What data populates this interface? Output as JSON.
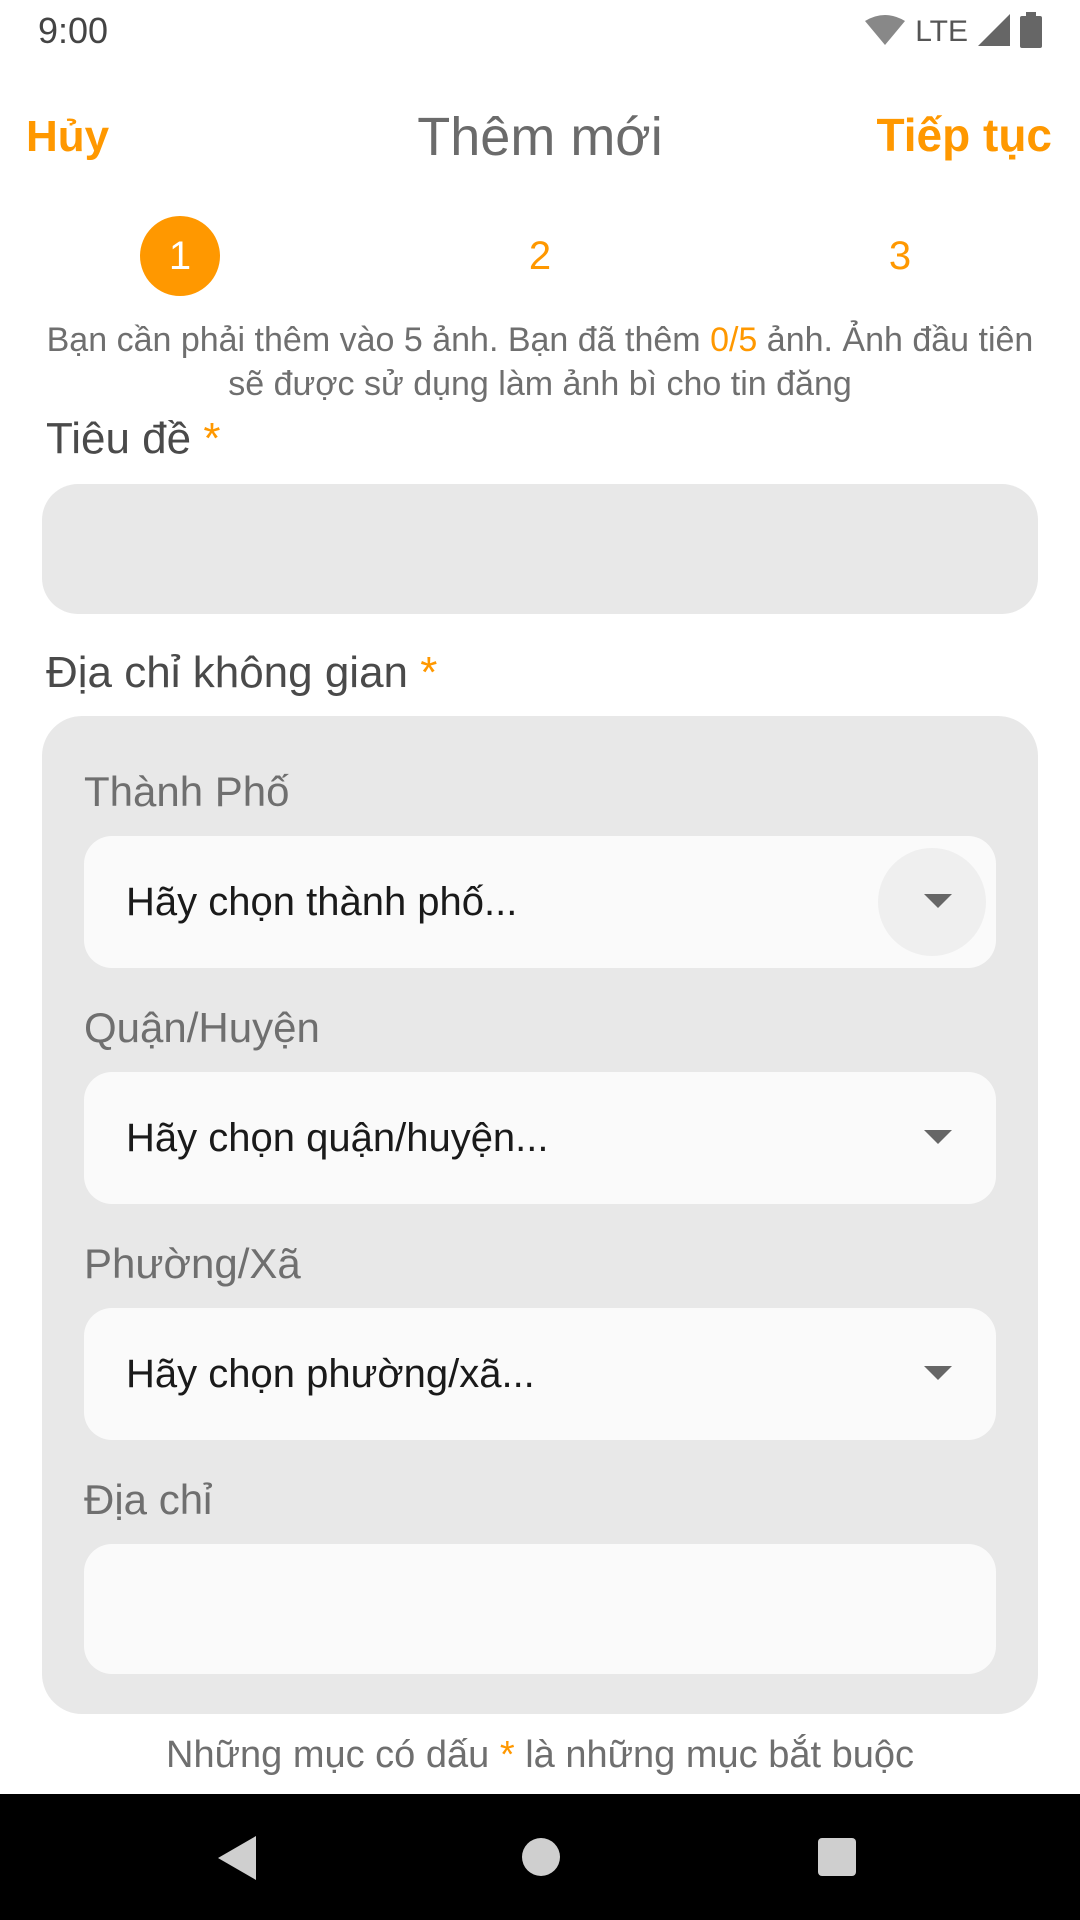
{
  "status_bar": {
    "time": "9:00",
    "network": "LTE",
    "icons": [
      "wifi-icon",
      "signal-icon",
      "battery-icon"
    ]
  },
  "app_bar": {
    "cancel_label": "Hủy",
    "title": "Thêm mới",
    "next_label": "Tiếp tục"
  },
  "steps": {
    "items": [
      "1",
      "2",
      "3"
    ],
    "active_index": 0
  },
  "hint": {
    "before": "Bạn cần phải thêm vào 5 ảnh. Bạn đã thêm ",
    "count": "0/5",
    "after": " ảnh. Ảnh đầu tiên sẽ được sử dụng làm ảnh bì cho tin đăng"
  },
  "form": {
    "title_label": "Tiêu đề",
    "required_mark": "*",
    "title_value": "",
    "address_label": "Địa chỉ không gian",
    "city_label": "Thành Phố",
    "city_placeholder": "Hãy chọn thành phố...",
    "district_label": "Quận/Huyện",
    "district_placeholder": "Hãy chọn quận/huyện...",
    "ward_label": "Phường/Xã",
    "ward_placeholder": "Hãy chọn phường/xã...",
    "street_label": "Địa chỉ",
    "street_value": ""
  },
  "footer": {
    "before": "Những mục có dấu ",
    "mark": "*",
    "after": " là những mục bắt buộc"
  },
  "colors": {
    "accent": "#ff9800",
    "field_bg": "#e8e8e8"
  }
}
